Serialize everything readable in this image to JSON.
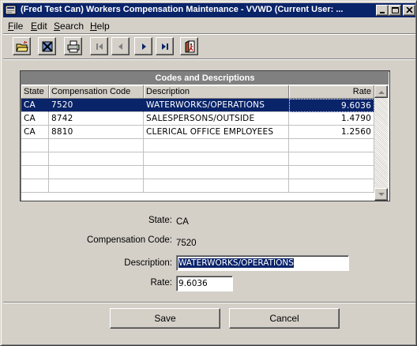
{
  "window": {
    "title": "(Fred Test Can) Workers Compensation Maintenance - VVWD (Current User: ..."
  },
  "menu": {
    "items": [
      {
        "label": "File",
        "underline": "F",
        "rest": "ile"
      },
      {
        "label": "Edit",
        "underline": "E",
        "rest": "dit"
      },
      {
        "label": "Search",
        "underline": "S",
        "rest": "earch"
      },
      {
        "label": "Help",
        "underline": "H",
        "rest": "elp"
      }
    ]
  },
  "toolbar": {
    "icons": [
      "open-folder-icon",
      "delete-icon",
      "print-icon",
      "first-record-icon",
      "previous-record-icon",
      "next-record-icon",
      "last-record-icon",
      "exit-door-icon"
    ]
  },
  "grid": {
    "caption": "Codes and Descriptions",
    "columns": [
      "State",
      "Compensation Code",
      "Description",
      "Rate"
    ],
    "rows": [
      {
        "state": "CA",
        "code": "7520",
        "description": "WATERWORKS/OPERATIONS",
        "rate": "9.6036",
        "selected": true
      },
      {
        "state": "CA",
        "code": "8742",
        "description": "SALESPERSONS/OUTSIDE",
        "rate": "1.4790",
        "selected": false
      },
      {
        "state": "CA",
        "code": "8810",
        "description": "CLERICAL OFFICE EMPLOYEES",
        "rate": "1.2560",
        "selected": false
      }
    ],
    "empty_rows": 4
  },
  "form": {
    "state_label": "State:",
    "state_value": "CA",
    "code_label": "Compensation Code:",
    "code_value": "7520",
    "description_label": "Description:",
    "description_value": "WATERWORKS/OPERATIONS",
    "rate_label": "Rate:",
    "rate_value": "9.6036"
  },
  "buttons": {
    "save": "Save",
    "cancel": "Cancel"
  },
  "colors": {
    "selection": "#0a246a",
    "face": "#d4d0c8",
    "caption_bar": "#808080"
  }
}
